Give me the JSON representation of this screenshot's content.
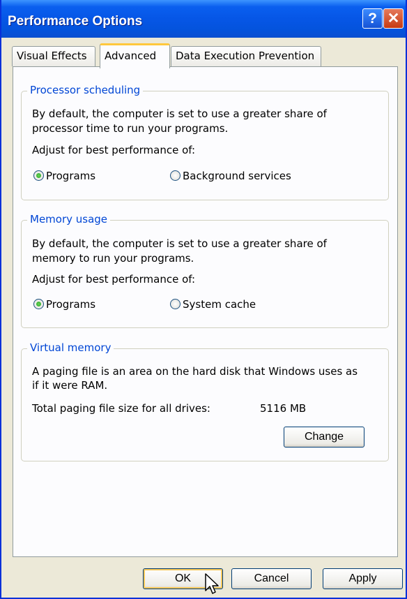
{
  "window": {
    "title": "Performance Options",
    "help_button": "?",
    "close_button": "✕"
  },
  "tabs": [
    {
      "label": "Visual Effects"
    },
    {
      "label": "Advanced"
    },
    {
      "label": "Data Execution Prevention"
    }
  ],
  "processor": {
    "legend": "Processor scheduling",
    "desc_line1": "By default, the computer is set to use a greater share of",
    "desc_line2": "processor time to run your programs.",
    "adjust": "Adjust for best performance of:",
    "option1": "Programs",
    "option2": "Background services",
    "selected": "Programs"
  },
  "memory": {
    "legend": "Memory usage",
    "desc_line1": "By default, the computer is set to use a greater share of",
    "desc_line2": "memory to run your programs.",
    "adjust": "Adjust for best performance of:",
    "option1": "Programs",
    "option2": "System cache",
    "selected": "Programs"
  },
  "virtual": {
    "legend": "Virtual memory",
    "desc_line1": "A paging file is an area on the hard disk that Windows uses as",
    "desc_line2": "if it were RAM.",
    "total_label": "Total paging file size for all drives:",
    "total_value": "5116 MB",
    "change_button": "Change"
  },
  "footer": {
    "ok": "OK",
    "cancel": "Cancel",
    "apply": "Apply"
  },
  "colors": {
    "titlebar": "#0A5FEF",
    "groupbox_title": "#0046D5",
    "dialog_bg": "#ECE9D8",
    "tab_highlight": "#FFC83C"
  }
}
